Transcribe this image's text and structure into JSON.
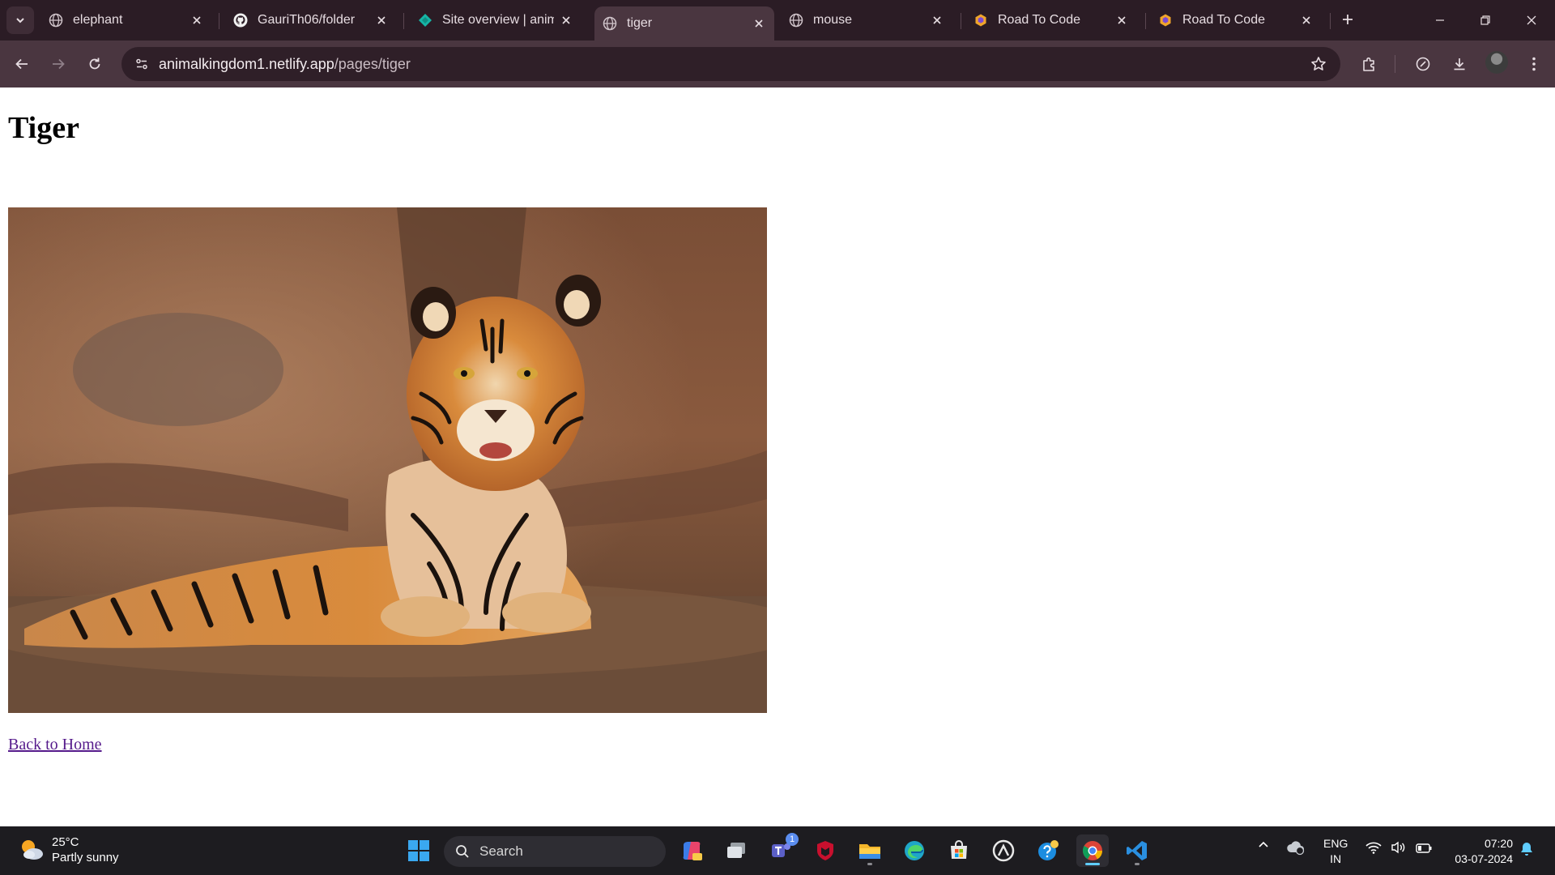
{
  "browser": {
    "tabs": [
      {
        "title": "elephant",
        "icon": "globe-icon",
        "active": false
      },
      {
        "title": "GauriTh06/folder",
        "icon": "github-icon",
        "active": false
      },
      {
        "title": "Site overview | anima",
        "icon": "netlify-icon",
        "active": false
      },
      {
        "title": "tiger",
        "icon": "globe-icon",
        "active": true
      },
      {
        "title": "mouse",
        "icon": "globe-icon",
        "active": false
      },
      {
        "title": "Road To Code",
        "icon": "hexagon-icon",
        "active": false
      },
      {
        "title": "Road To Code",
        "icon": "hexagon-icon",
        "active": false
      }
    ],
    "url_host": "animalkingdom1.netlify.app",
    "url_path": "/pages/tiger"
  },
  "page": {
    "heading": "Tiger",
    "image_alt": "tiger",
    "back_link": "Back to Home"
  },
  "taskbar": {
    "weather_temp": "25°C",
    "weather_desc": "Partly sunny",
    "search_placeholder": "Search",
    "teams_badge": "1",
    "lang_top": "ENG",
    "lang_bottom": "IN",
    "time": "07:20",
    "date": "03-07-2024"
  },
  "colors": {
    "tabbar": "#2b1c25",
    "toolbar": "#4a3640",
    "link": "#551a8b",
    "taskbar": "#1d1c20"
  }
}
